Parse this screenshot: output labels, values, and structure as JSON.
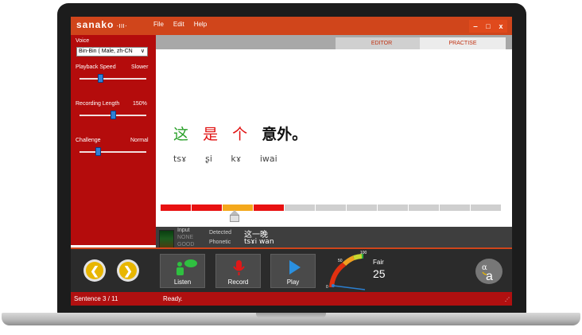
{
  "app": {
    "brand": "sanako",
    "brand_wave": "·ııı·"
  },
  "menu": [
    "File",
    "Edit",
    "Help"
  ],
  "window_controls": {
    "minimize": "‒",
    "maximize": "□",
    "close": "x"
  },
  "sidebar": {
    "voice_label": "Voice",
    "voice_value": "Bin-Bin ( Male, zh-CN",
    "playback_speed_label": "Playback Speed",
    "playback_speed_value": "Slower",
    "recording_length_label": "Recording Length",
    "recording_length_value": "150%",
    "challenge_label": "Challenge",
    "challenge_value": "Normal"
  },
  "tabs": {
    "editor": "EDITOR",
    "practise": "PRACTISE"
  },
  "sentence": {
    "words": [
      {
        "text": "这",
        "color": "#2aa02a"
      },
      {
        "text": "是",
        "color": "#e01010"
      },
      {
        "text": "个",
        "color": "#e01010"
      },
      {
        "text": "意外。",
        "color": "#111111"
      }
    ],
    "phonetics": [
      "tsɤ",
      "ʂi",
      "kɤ",
      "iwai"
    ]
  },
  "score_segments": [
    "#e81111",
    "#e81111",
    "#f4a81c",
    "#e81111",
    "#cfcfcf",
    "#cfcfcf",
    "#cfcfcf",
    "#cfcfcf",
    "#cfcfcf",
    "#cfcfcf",
    "#cfcfcf"
  ],
  "detection": {
    "input_label": "Input",
    "input_none": "NONE",
    "input_good": "GOOD",
    "detected_label": "Detected",
    "detected_value": "这一晚",
    "phonetic_label": "Phonetic",
    "phonetic_value": "tsɤi wan"
  },
  "toolbar": {
    "listen": "Listen",
    "record": "Record",
    "play": "Play",
    "gauge_max": "100",
    "gauge_mid": "50",
    "gauge_min": "0",
    "rating_label": "Fair",
    "rating_value": "25"
  },
  "status": {
    "sentence": "Sentence 3 / 11",
    "state": "Ready."
  }
}
